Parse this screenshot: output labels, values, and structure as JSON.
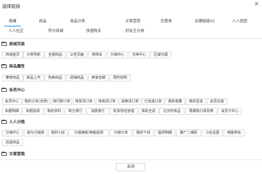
{
  "dialog": {
    "title": "选择链接",
    "close_glyph": "×"
  },
  "tabs": [
    "商城",
    "商品",
    "商品分类",
    "文章营销",
    "优惠券",
    "店铺链接V2",
    "人人拼团",
    "人人社区",
    "积分商城",
    "快速购买",
    "好友互分券"
  ],
  "active_tab": "商城",
  "sections": [
    {
      "title": "商城页面",
      "items": [
        "商城首页",
        "分类导航",
        "全部商品",
        "公告页面",
        "购物车",
        "分销中心",
        "兑换中心",
        "区域代理"
      ]
    },
    {
      "title": "商品属性",
      "items": [
        "推荐商品",
        "新品上市",
        "热卖商品",
        "促销商品",
        "卖家包邮",
        "限时抢购"
      ]
    },
    {
      "title": "会员中心",
      "items": [
        "会员中心",
        "我的订单(全部)",
        "待付款订单",
        "待发货订单",
        "待收货订单",
        "退换货订单",
        "已完成订单",
        "我的收藏",
        "我的足迹",
        "会员充值",
        "余额明细",
        "余额提现",
        "我的资料",
        "积分排行",
        "消费排行",
        "收货地址管理",
        "我的全返",
        "记次时商品",
        "周期购订单列表",
        "会员卡中心"
      ]
    },
    {
      "title": "人人分销",
      "items": [
        "分销中心",
        "成为分销商",
        "我的小店",
        "分销佣金/佣金提现",
        "分销订单",
        "我的下线",
        "提现明细",
        "推广二维码",
        "小店设置",
        "佣金排名",
        "自选商品"
      ]
    },
    {
      "title": "文章营销",
      "items": []
    }
  ],
  "footer": {
    "close_label": "关闭"
  },
  "colors": {
    "accent": "#1890ff",
    "chip_border": "#dcdcdc"
  },
  "icons": {
    "section_icon": "folder-icon",
    "close_icon": "close-icon"
  }
}
